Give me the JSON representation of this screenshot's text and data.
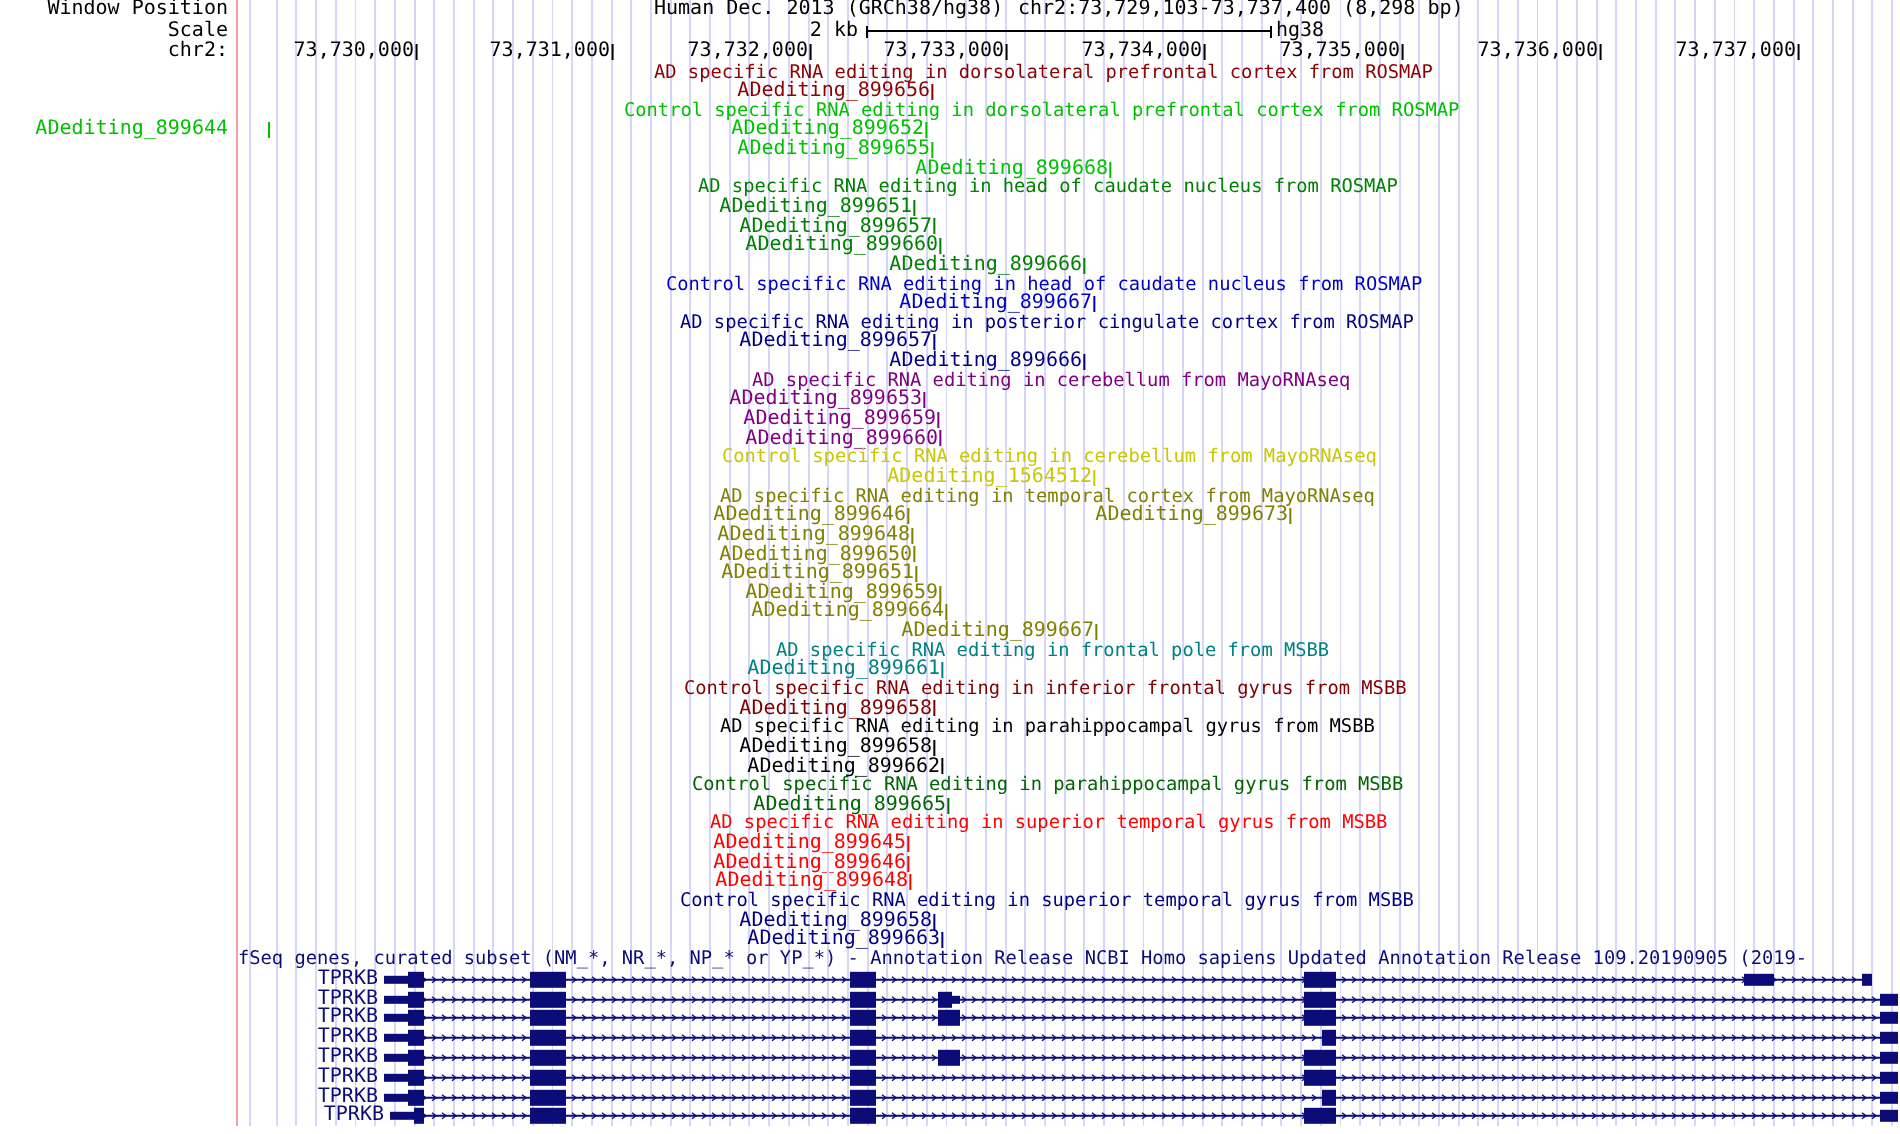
{
  "header": {
    "window_position_label": "Window Position",
    "assembly": "Human Dec. 2013 (GRCh38/hg38)",
    "position": "chr2:73,729,103-73,737,400 (8,298 bp)",
    "scale_label": "Scale",
    "scale_size": "2 kb",
    "scale_assembly": "hg38",
    "chrom_label": "chr2:",
    "ticks": [
      "73,730,000",
      "73,731,000",
      "73,732,000",
      "73,733,000",
      "73,734,000",
      "73,735,000",
      "73,736,000",
      "73,737,000"
    ]
  },
  "tracks": [
    {
      "title": "AD specific RNA editing in dorsolateral prefrontal cortex from ROSMAP",
      "color": "#8b0000",
      "rows": [
        {
          "features": [
            "ADediting_899656"
          ]
        }
      ]
    },
    {
      "title": "Control specific RNA editing in dorsolateral prefrontal cortex from ROSMAP",
      "color": "#00c000",
      "rows": [
        {
          "features": [
            "ADediting_899644",
            "ADediting_899652"
          ]
        },
        {
          "features": [
            "ADediting_899655"
          ]
        },
        {
          "features": [
            "ADediting_899668"
          ]
        }
      ]
    },
    {
      "title": "AD specific RNA editing in head of caudate nucleus from ROSMAP",
      "color": "#008000",
      "rows": [
        {
          "features": [
            "ADediting_899651"
          ]
        },
        {
          "features": [
            "ADediting_899657"
          ]
        },
        {
          "features": [
            "ADediting_899660"
          ]
        },
        {
          "features": [
            "ADediting_899666"
          ]
        }
      ]
    },
    {
      "title": "Control specific RNA editing in head of caudate nucleus from ROSMAP",
      "color": "#0000c0",
      "rows": [
        {
          "features": [
            "ADediting_899667"
          ]
        }
      ]
    },
    {
      "title": "AD specific RNA editing in posterior cingulate cortex from ROSMAP",
      "color": "#000080",
      "rows": [
        {
          "features": [
            "ADediting_899657"
          ]
        },
        {
          "features": [
            "ADediting_899666"
          ]
        }
      ]
    },
    {
      "title": "AD specific RNA editing in cerebellum from MayoRNAseq",
      "color": "#800080",
      "rows": [
        {
          "features": [
            "ADediting_899653"
          ]
        },
        {
          "features": [
            "ADediting_899659"
          ]
        },
        {
          "features": [
            "ADediting_899660"
          ]
        }
      ]
    },
    {
      "title": "Control specific RNA editing in cerebellum from MayoRNAseq",
      "color": "#c8c800",
      "rows": [
        {
          "features": [
            "ADediting_1564512"
          ]
        }
      ]
    },
    {
      "title": "AD specific RNA editing in temporal cortex from MayoRNAseq",
      "color": "#808000",
      "rows": [
        {
          "features": [
            "ADediting_899646",
            "ADediting_899673"
          ]
        },
        {
          "features": [
            "ADediting_899648"
          ]
        },
        {
          "features": [
            "ADediting_899650"
          ]
        },
        {
          "features": [
            "ADediting_899651"
          ]
        },
        {
          "features": [
            "ADediting_899659"
          ]
        },
        {
          "features": [
            "ADediting_899664"
          ]
        },
        {
          "features": [
            "ADediting_899667"
          ]
        }
      ]
    },
    {
      "title": "AD specific RNA editing in frontal pole from MSBB",
      "color": "#008080",
      "rows": [
        {
          "features": [
            "ADediting_899661"
          ]
        }
      ]
    },
    {
      "title": "Control specific RNA editing in inferior frontal gyrus from MSBB",
      "color": "#800000",
      "rows": [
        {
          "features": [
            "ADediting_899658"
          ]
        }
      ]
    },
    {
      "title": "AD specific RNA editing in parahippocampal gyrus from MSBB",
      "color": "#000000",
      "rows": [
        {
          "features": [
            "ADediting_899658"
          ]
        },
        {
          "features": [
            "ADediting_899662"
          ]
        }
      ]
    },
    {
      "title": "Control specific RNA editing in parahippocampal gyrus from MSBB",
      "color": "#006400",
      "rows": [
        {
          "features": [
            "ADediting_899665"
          ]
        }
      ]
    },
    {
      "title": "AD specific RNA editing in superior temporal gyrus from MSBB",
      "color": "#ff0000",
      "rows": [
        {
          "features": [
            "ADediting_899645"
          ]
        },
        {
          "features": [
            "ADediting_899646"
          ]
        },
        {
          "features": [
            "ADediting_899648"
          ]
        }
      ]
    },
    {
      "title": "Control specific RNA editing in superior temporal gyrus from MSBB",
      "color": "#000080",
      "rows": [
        {
          "features": [
            "ADediting_899658"
          ]
        },
        {
          "features": [
            "ADediting_899663"
          ]
        }
      ]
    }
  ],
  "refseq": {
    "title": "fSeq genes, curated subset (NM_*, NR_*, NP_* or YP_*) - Annotation Release NCBI Homo sapiens Updated Annotation Release 109.20190905 (2019-",
    "genes": [
      "TPRKB",
      "TPRKB",
      "TPRKB",
      "TPRKB",
      "TPRKB",
      "TPRKB",
      "TPRKB",
      "TPRKB"
    ]
  }
}
